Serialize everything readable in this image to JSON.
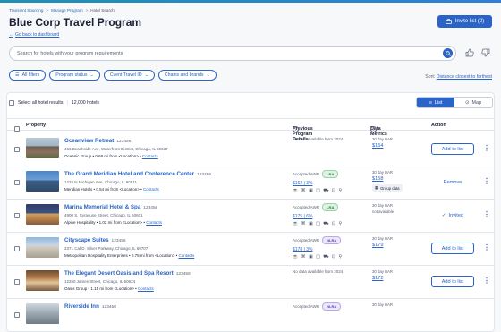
{
  "breadcrumb": [
    "Transient Sourcing",
    "Manage Program",
    "Hotel Search"
  ],
  "page_title": "Blue Corp Travel Program",
  "back_link": "Go back to dashboard",
  "invite_button": "Invite list (2)",
  "search": {
    "placeholder": "Search for hotels with your program requirements"
  },
  "filters": [
    "All filters",
    "Program status",
    "Cvent Travel ID",
    "Chains and brands"
  ],
  "sort": {
    "label": "Sort:",
    "value": "Distance closest to farthest"
  },
  "select_all": "Select all hotel results",
  "result_count": "12,000 hotels",
  "view_toggle": {
    "list": "List",
    "map": "Map"
  },
  "columns": {
    "property": "Property",
    "previous": "Previous Program Details",
    "metrics": "Data Metrics",
    "action": "Action"
  },
  "rows": [
    {
      "name": "Oceanview Retreat",
      "id": "123456",
      "address": "456 Beachside Ave, Waterfront District, Chicago, IL 60637",
      "chain": "Oceanic Group • 0.68 mi from <Location> •",
      "contacts": "Contacts",
      "prev_text": "No data available from 2024",
      "metric_label": "30 day BAR",
      "metric_value": "$154",
      "action": "Add to list"
    },
    {
      "name": "The Grand Meridian Hotel and Conference Center",
      "id": "123456",
      "address": "1234 N Michigan Ave, Chicago, IL 60611",
      "chain": "Meridian Hotels • 0.54 mi from <Location> •",
      "contacts": "Contacts",
      "prev_text": "Accepted AWR",
      "badge": "LRA",
      "rates": "$162 | 3%",
      "metric_label": "30 day BAR",
      "metric_value": "$158",
      "group_data": "Group data",
      "action": "Remove"
    },
    {
      "name": "Marina Memorial Hotel & Spa",
      "id": "123456",
      "address": "4900 S. Syracuse Street, Chicago, IL 60601",
      "chain": "Alpine Hospitality • 1.02 mi from <Location> •",
      "contacts": "Contacts",
      "prev_text": "Accepted AWR",
      "badge": "LRA",
      "rates": "$175 | 6%",
      "metric_label": "30 day BAR",
      "metric_na": "not available",
      "action": "Invited"
    },
    {
      "name": "Cityscape Suites",
      "id": "123456",
      "address": "2371 Cal D. Silver Parkway, Chicago, IL 60707",
      "chain": "Metropolitan Hospitality Enterprises • 0.75 mi from <Location> •",
      "contacts": "Contacts",
      "prev_text": "Accepted AWR",
      "badge": "NLRA",
      "rates": "$178 | 3%",
      "metric_label": "30 day BAR",
      "metric_value": "$179",
      "action": "Add to list"
    },
    {
      "name": "The Elegant Desert Oasis and Spa Resort",
      "id": "123456",
      "address": "12260 James Street, Chicago, IL 60624",
      "chain": "Oasis Group • 1.15 mi from <Location> •",
      "contacts": "Contacts",
      "prev_text": "No data available from 2024",
      "metric_label": "30 day BAR",
      "metric_value": "$172",
      "action": "Add to list"
    },
    {
      "name": "Riverside Inn",
      "id": "123456",
      "prev_text": "Accepted AWR",
      "badge": "NLRA",
      "metric_label": "30 day BAR"
    }
  ],
  "colors": {
    "primary": "#2a64c6",
    "lra": "#2c7a3f",
    "nlra": "#5b3fb3"
  }
}
